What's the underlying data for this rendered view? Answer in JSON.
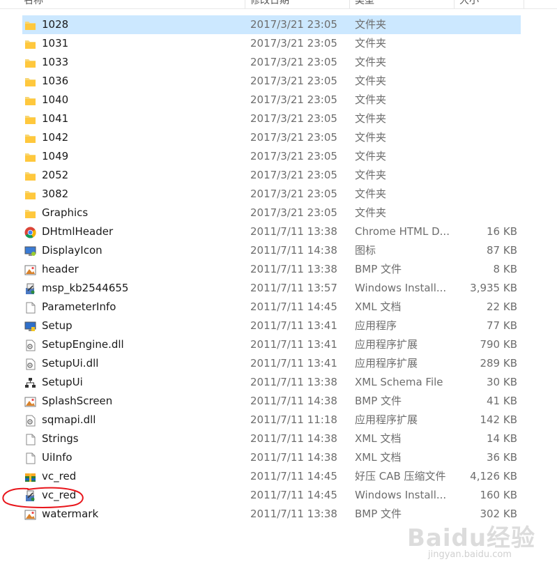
{
  "columns": {
    "name": "名称",
    "date": "修改日期",
    "type": "类型",
    "size": "大小"
  },
  "colors": {
    "selected_row": "#cce8ff",
    "annotation": "#e8151b"
  },
  "files": [
    {
      "name": "1028",
      "date": "2017/3/21 23:05",
      "type": "文件夹",
      "size": "",
      "icon": "folder-icon",
      "selected": true
    },
    {
      "name": "1031",
      "date": "2017/3/21 23:05",
      "type": "文件夹",
      "size": "",
      "icon": "folder-icon"
    },
    {
      "name": "1033",
      "date": "2017/3/21 23:05",
      "type": "文件夹",
      "size": "",
      "icon": "folder-icon"
    },
    {
      "name": "1036",
      "date": "2017/3/21 23:05",
      "type": "文件夹",
      "size": "",
      "icon": "folder-icon"
    },
    {
      "name": "1040",
      "date": "2017/3/21 23:05",
      "type": "文件夹",
      "size": "",
      "icon": "folder-icon"
    },
    {
      "name": "1041",
      "date": "2017/3/21 23:05",
      "type": "文件夹",
      "size": "",
      "icon": "folder-icon"
    },
    {
      "name": "1042",
      "date": "2017/3/21 23:05",
      "type": "文件夹",
      "size": "",
      "icon": "folder-icon"
    },
    {
      "name": "1049",
      "date": "2017/3/21 23:05",
      "type": "文件夹",
      "size": "",
      "icon": "folder-icon"
    },
    {
      "name": "2052",
      "date": "2017/3/21 23:05",
      "type": "文件夹",
      "size": "",
      "icon": "folder-icon"
    },
    {
      "name": "3082",
      "date": "2017/3/21 23:05",
      "type": "文件夹",
      "size": "",
      "icon": "folder-icon"
    },
    {
      "name": "Graphics",
      "date": "2017/3/21 23:05",
      "type": "文件夹",
      "size": "",
      "icon": "folder-icon"
    },
    {
      "name": "DHtmlHeader",
      "date": "2011/7/11 13:38",
      "type": "Chrome HTML D...",
      "size": "16 KB",
      "icon": "chrome-icon"
    },
    {
      "name": "DisplayIcon",
      "date": "2011/7/11 14:38",
      "type": "图标",
      "size": "87 KB",
      "icon": "display-icon"
    },
    {
      "name": "header",
      "date": "2011/7/11 13:38",
      "type": "BMP 文件",
      "size": "8 KB",
      "icon": "bmp-icon"
    },
    {
      "name": "msp_kb2544655",
      "date": "2011/7/11 13:57",
      "type": "Windows Install...",
      "size": "3,935 KB",
      "icon": "installer-icon"
    },
    {
      "name": "ParameterInfo",
      "date": "2011/7/11 14:45",
      "type": "XML 文档",
      "size": "22 KB",
      "icon": "document-icon"
    },
    {
      "name": "Setup",
      "date": "2011/7/11 13:41",
      "type": "应用程序",
      "size": "77 KB",
      "icon": "setup-icon"
    },
    {
      "name": "SetupEngine.dll",
      "date": "2011/7/11 13:41",
      "type": "应用程序扩展",
      "size": "790 KB",
      "icon": "dll-icon"
    },
    {
      "name": "SetupUi.dll",
      "date": "2011/7/11 13:41",
      "type": "应用程序扩展",
      "size": "289 KB",
      "icon": "dll-icon"
    },
    {
      "name": "SetupUi",
      "date": "2011/7/11 13:38",
      "type": "XML Schema File",
      "size": "30 KB",
      "icon": "schema-icon"
    },
    {
      "name": "SplashScreen",
      "date": "2011/7/11 14:38",
      "type": "BMP 文件",
      "size": "41 KB",
      "icon": "bmp-icon"
    },
    {
      "name": "sqmapi.dll",
      "date": "2011/7/11 11:18",
      "type": "应用程序扩展",
      "size": "142 KB",
      "icon": "dll-icon"
    },
    {
      "name": "Strings",
      "date": "2011/7/11 14:38",
      "type": "XML 文档",
      "size": "14 KB",
      "icon": "document-icon"
    },
    {
      "name": "UiInfo",
      "date": "2011/7/11 14:38",
      "type": "XML 文档",
      "size": "36 KB",
      "icon": "document-icon"
    },
    {
      "name": "vc_red",
      "date": "2011/7/11 14:45",
      "type": "好压 CAB 压缩文件",
      "size": "4,126 KB",
      "icon": "archive-icon"
    },
    {
      "name": "vc_red",
      "date": "2011/7/11 14:45",
      "type": "Windows Install...",
      "size": "160 KB",
      "icon": "installer-icon"
    },
    {
      "name": "watermark",
      "date": "2011/7/11 13:38",
      "type": "BMP 文件",
      "size": "302 KB",
      "icon": "bmp-icon"
    }
  ],
  "watermark": {
    "brand": "Baidu经验",
    "url": "jingyan.baidu.com"
  }
}
